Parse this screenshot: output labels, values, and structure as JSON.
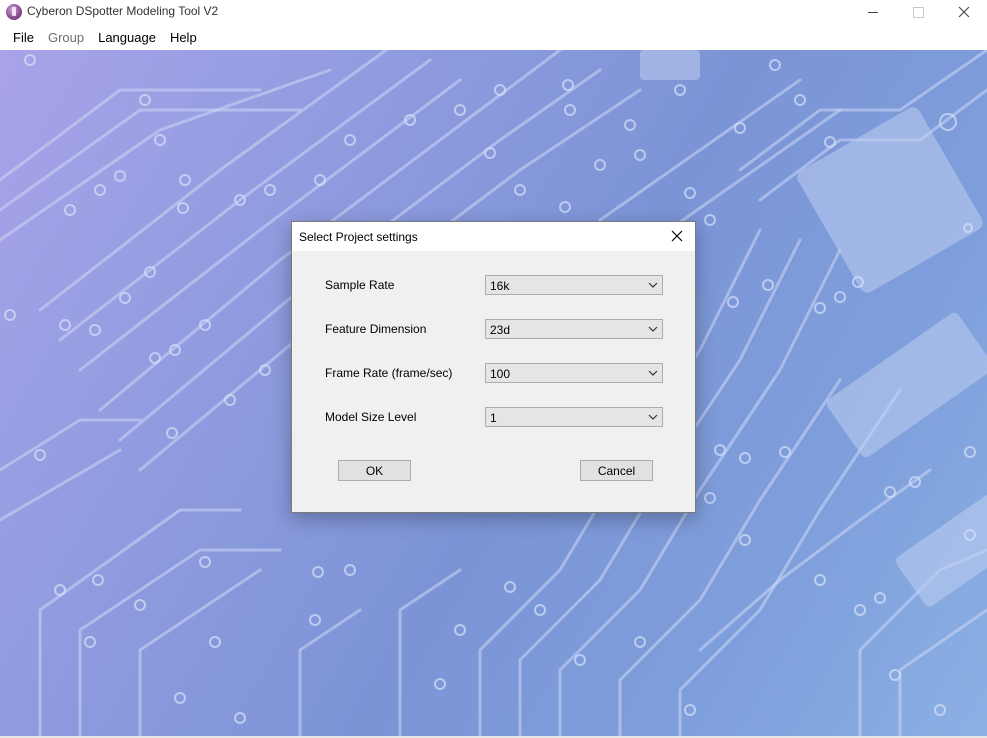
{
  "window": {
    "title": "Cyberon DSpotter Modeling Tool V2",
    "icon": "app-logo-icon"
  },
  "menu": {
    "items": [
      {
        "label": "File",
        "enabled": true
      },
      {
        "label": "Group",
        "enabled": false
      },
      {
        "label": "Language",
        "enabled": true
      },
      {
        "label": "Help",
        "enabled": true
      }
    ]
  },
  "dialog": {
    "title": "Select Project settings",
    "fields": [
      {
        "label": "Sample Rate",
        "value": "16k"
      },
      {
        "label": "Feature Dimension",
        "value": "23d"
      },
      {
        "label": "Frame Rate (frame/sec)",
        "value": "100"
      },
      {
        "label": "Model Size Level",
        "value": "1"
      }
    ],
    "ok_label": "OK",
    "cancel_label": "Cancel"
  },
  "colors": {
    "background_start": "#a9a3e9",
    "background_end": "#8cb0e4",
    "dialog_bg": "#f0f0f0",
    "button_bg": "#e1e1e1"
  }
}
